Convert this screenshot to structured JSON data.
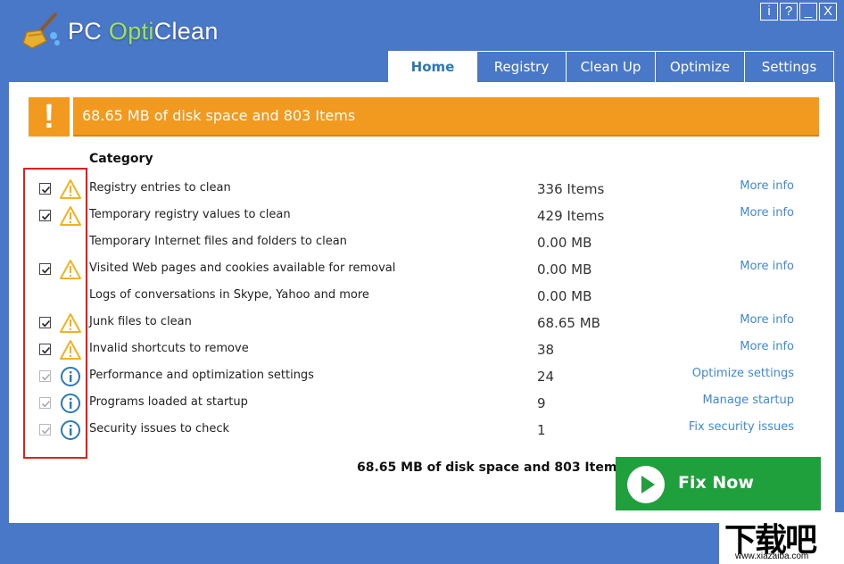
{
  "app": {
    "title_part1": "PC ",
    "title_part2": "Opti",
    "title_part3": "Clean"
  },
  "window_controls": [
    "i",
    "?",
    "_",
    "X"
  ],
  "tabs": [
    {
      "label": "Home",
      "active": true
    },
    {
      "label": "Registry",
      "active": false
    },
    {
      "label": "Clean Up",
      "active": false
    },
    {
      "label": "Optimize",
      "active": false
    },
    {
      "label": "Settings",
      "active": false
    }
  ],
  "banner": {
    "icon": "!",
    "text": "68.65 MB of disk space and 803 Items"
  },
  "category_header": "Category",
  "rows": [
    {
      "label": "Registry entries to clean",
      "value": "336 Items",
      "link": "More info",
      "checked": true,
      "icon": "warning-icon"
    },
    {
      "label": "Temporary registry values to clean",
      "value": "429 Items",
      "link": "More info",
      "checked": true,
      "icon": "warning-icon"
    },
    {
      "label": "Temporary Internet files and folders to clean",
      "value": "0.00 MB",
      "link": "",
      "checked": false,
      "icon": ""
    },
    {
      "label": "Visited Web pages and cookies available for removal",
      "value": "0.00 MB",
      "link": "More info",
      "checked": true,
      "icon": "warning-icon"
    },
    {
      "label": "Logs of conversations in Skype, Yahoo and more",
      "value": "0.00 MB",
      "link": "",
      "checked": false,
      "icon": ""
    },
    {
      "label": "Junk files to clean",
      "value": "68.65 MB",
      "link": "More info",
      "checked": true,
      "icon": "warning-icon"
    },
    {
      "label": "Invalid shortcuts to remove",
      "value": "38",
      "link": "More info",
      "checked": true,
      "icon": "warning-icon"
    },
    {
      "label": "Performance and optimization settings",
      "value": "24",
      "link": "Optimize settings",
      "checked": true,
      "icon": "info-icon"
    },
    {
      "label": "Programs loaded at startup",
      "value": "9",
      "link": "Manage startup",
      "checked": true,
      "icon": "info-icon"
    },
    {
      "label": "Security issues to check",
      "value": "1",
      "link": "Fix security issues",
      "checked": true,
      "icon": "info-icon"
    }
  ],
  "summary": "68.65 MB of disk space and 803 Items",
  "fix_button": "Fix Now",
  "watermark": {
    "cn": "下载吧",
    "url": "www.xiazaiba.com"
  },
  "colors": {
    "frame": "#4a78c8",
    "banner": "#f29a1f",
    "fix_button": "#1fa03c",
    "link": "#3d8ad8",
    "warning": "#f2b21f",
    "info": "#2a7ab8",
    "highlight": "#e02020"
  }
}
